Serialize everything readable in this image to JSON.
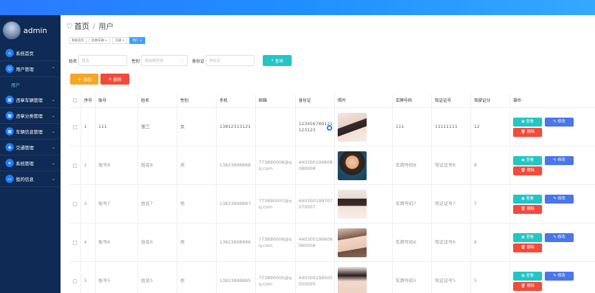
{
  "sidebar": {
    "username": "admin",
    "items": [
      {
        "label": "系统首页",
        "icon": "home-icon",
        "chevron": ""
      },
      {
        "label": "用户管理",
        "icon": "user-icon",
        "chevron": "⌃"
      },
      {
        "label": "违章车辆管理",
        "icon": "grid-icon",
        "chevron": "⌄"
      },
      {
        "label": "违章分类管理",
        "icon": "grid-icon",
        "chevron": "⌄"
      },
      {
        "label": "车辆信息管理",
        "icon": "grid-icon",
        "chevron": "⌄"
      },
      {
        "label": "交通管理",
        "icon": "shield-icon",
        "chevron": "⌄"
      },
      {
        "label": "系统管理",
        "icon": "send-icon",
        "chevron": "⌄"
      },
      {
        "label": "我的信息",
        "icon": "card-icon",
        "chevron": "⌄"
      }
    ],
    "submenu_label": "用户"
  },
  "breadcrumb": {
    "home": "首页",
    "sep": "/",
    "current": "用户"
  },
  "tags": [
    "系统首页",
    "违章车辆 ×",
    "交通 ×",
    "用户 ×"
  ],
  "search": {
    "name_label": "姓名",
    "name_placeholder": "姓名",
    "gender_label": "性别",
    "gender_placeholder": "请选择性别",
    "id_label": "身份证",
    "id_placeholder": "身份证",
    "query_label": "查询"
  },
  "actions": {
    "add_label": "添加",
    "delete_label": "删除"
  },
  "table": {
    "headers": [
      "序号",
      "账号",
      "姓名",
      "性别",
      "手机",
      "邮箱",
      "身份证",
      "照片",
      "车牌号码",
      "驾证证号",
      "驾驶证分",
      "操作"
    ],
    "view_label": "查看",
    "edit_label": "修改",
    "delete_label": "删除",
    "rows": [
      {
        "idx": "1",
        "account": "111",
        "name": "张三",
        "gender": "女",
        "phone": "13812313121",
        "email": "",
        "idcard": "123456789121123123",
        "plate": "111",
        "license": "11111111",
        "points": "12"
      },
      {
        "idx": "2",
        "account": "账号8",
        "name": "姓名8",
        "gender": "男",
        "phone": "13823888888",
        "email": "773890008@qq.com",
        "idcard": "440300199808080008",
        "plate": "车牌号码8",
        "license": "驾证证号8",
        "points": "8"
      },
      {
        "idx": "3",
        "account": "账号7",
        "name": "姓名7",
        "gender": "男",
        "phone": "13823888887",
        "email": "773890007@qq.com",
        "idcard": "440300199707070007",
        "plate": "车牌号码7",
        "license": "驾证证号7",
        "points": "7"
      },
      {
        "idx": "4",
        "account": "账号6",
        "name": "姓名6",
        "gender": "男",
        "phone": "13823888886",
        "email": "773890006@qq.com",
        "idcard": "440300199606060006",
        "plate": "车牌号码6",
        "license": "驾证证号6",
        "points": "6"
      },
      {
        "idx": "5",
        "account": "账号5",
        "name": "姓名5",
        "gender": "男",
        "phone": "13823888885",
        "email": "773890005@qq.com",
        "idcard": "440300199505050005",
        "plate": "车牌号码5",
        "license": "驾证证号5",
        "points": "5"
      }
    ]
  },
  "colors": {
    "topbar": "#2b79ff",
    "sidebar": "#0f2a54",
    "query": "#23c5c5",
    "add": "#f5a623",
    "danger": "#f44a3a",
    "edit": "#4a76e8"
  }
}
